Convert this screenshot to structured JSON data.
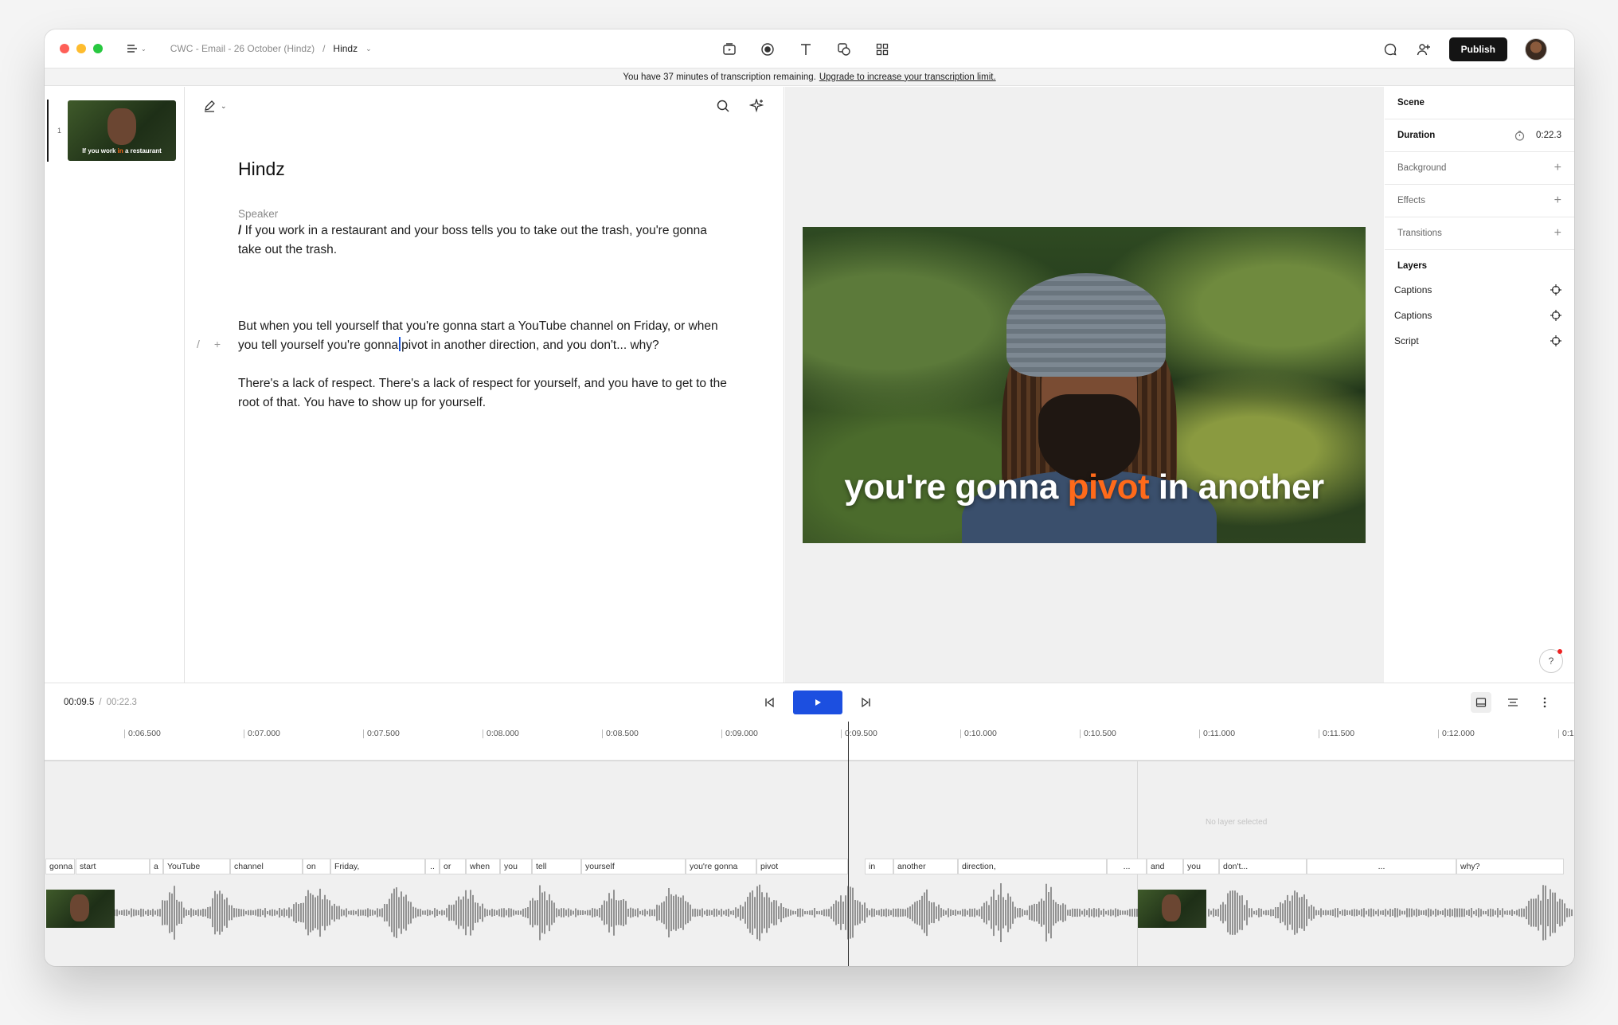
{
  "titlebar": {
    "project_name": "CWC - Email - 26 October (Hindz)",
    "separator": "/",
    "scene_name": "Hindz",
    "publish_label": "Publish"
  },
  "banner": {
    "text": "You have 37 minutes of transcription remaining.",
    "link": "Upgrade to increase your transcription limit."
  },
  "rail": {
    "scene_number": "1",
    "thumb_caption_pre": "If you work ",
    "thumb_caption_hl": "in",
    "thumb_caption_post": " a restaurant"
  },
  "editor": {
    "title": "Hindz",
    "speaker": "Speaker",
    "p1_slash": "/",
    "p1": "If you work in a restaurant and your boss tells you to take out the trash, you're gonna take out the trash.",
    "p2_a": "But when you tell yourself that you're gonna start a YouTube channel on Friday, or when you tell yourself you're gonna",
    "p2_b": "pivot in another direction,",
    "p2_c": "and you don't... why?",
    "p3": "There's a lack of respect. There's a lack of respect for yourself, and you have to get to the root of that. You have to show up for yourself.",
    "gutter_slash": "/",
    "gutter_plus": "+"
  },
  "preview": {
    "caption_pre": "you're gonna ",
    "caption_hl": "pivot",
    "caption_post": " in another",
    "accent_color": "#ff6a1a"
  },
  "props": {
    "scene_label": "Scene",
    "duration_label": "Duration",
    "duration_value": "0:22.3",
    "background_label": "Background",
    "effects_label": "Effects",
    "transitions_label": "Transitions",
    "layers_title": "Layers",
    "layers": [
      "Captions",
      "Captions",
      "Script"
    ],
    "help": "?"
  },
  "transport": {
    "current_time": "00:09.5",
    "separator": "/",
    "total_time": "00:22.3",
    "play_color": "#1c4fe0"
  },
  "timeline": {
    "ticks": [
      "0:06.500",
      "0:07.000",
      "0:07.500",
      "0:08.000",
      "0:08.500",
      "0:09.000",
      "0:09.500",
      "0:10.000",
      "0:10.500",
      "0:11.000",
      "0:11.500",
      "0:12.000",
      "0:1"
    ],
    "no_layer": "No layer selected",
    "words": [
      "gonna",
      "start",
      "a",
      "YouTube",
      "channel",
      "on",
      "Friday,",
      "..",
      "or",
      "when",
      "you",
      "tell",
      "yourself",
      "you're gonna",
      "pivot",
      "in",
      "another",
      "direction,",
      "...",
      "and",
      "you",
      "don't...",
      "...",
      "why?"
    ]
  }
}
